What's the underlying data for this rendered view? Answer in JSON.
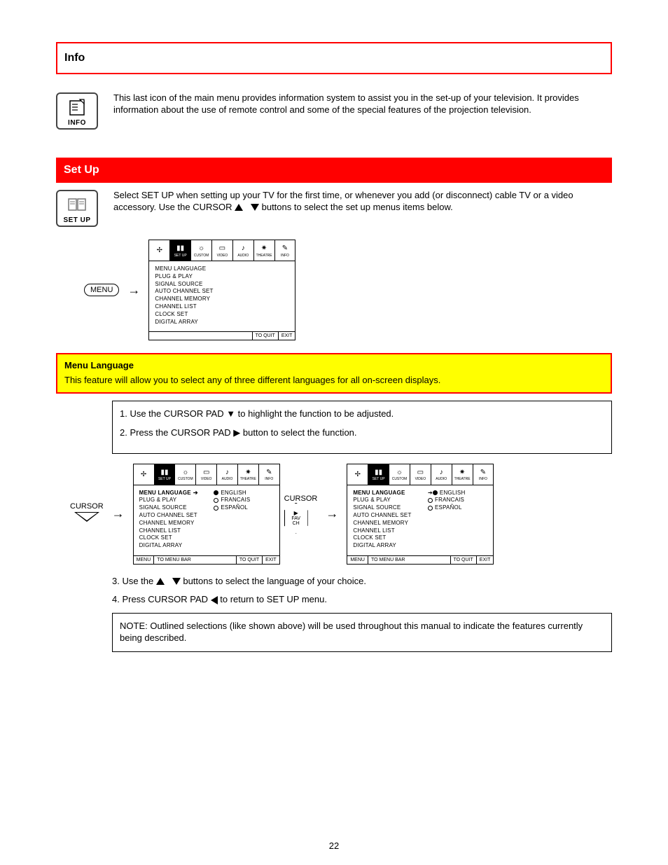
{
  "info_box_title": "Info",
  "info_desc": "This last icon of the main menu provides information system to assist you in the set-up of your television. It provides information about the use of remote control and some of the special features of the projection television.",
  "info_icon_label": "INFO",
  "setup_heading": "Set Up",
  "setup_intro_a": "Select SET UP when setting up your TV for the first time, or whenever you",
  "setup_intro_b": "add (or disconnect) cable TV or a video accessory. Use the CURSOR ",
  "setup_intro_c": " buttons to select the set up menus items below.",
  "setup_icon_label": "SET UP",
  "menu_label": "MENU",
  "cursor_label": "CURSOR",
  "fav_line1": "FAV",
  "fav_line2": "CH",
  "menu_bar": [
    "SET UP",
    "CUSTOM",
    "VIDEO",
    "AUDIO",
    "THEATRE",
    "INFO"
  ],
  "menu_items": [
    "MENU LANGUAGE",
    "PLUG & PLAY",
    "SIGNAL SOURCE",
    "AUTO CHANNEL SET",
    "CHANNEL MEMORY",
    "CHANNEL LIST",
    "CLOCK SET",
    "DIGITAL ARRAY"
  ],
  "lang_options": [
    "ENGLISH",
    "FRANCAIS",
    "ESPAÑOL"
  ],
  "foot_menu": "MENU",
  "foot_menubar": "TO MENU BAR",
  "foot_quit": "TO QUIT",
  "foot_exit": "EXIT",
  "lang_title": "Menu Language",
  "lang_desc": "This feature will allow you to select any of three different languages for all on-screen displays.",
  "step1": "1. Use the CURSOR PAD ▼ to highlight the function to be adjusted.",
  "step2": "2. Press the CURSOR PAD ▶ button to select the function.",
  "step_p1": "3. Use the ",
  "step_p2": " buttons to select the language of your choice.",
  "step_p3": "4. Press CURSOR PAD ",
  "step_p4": " to return to SET UP menu.",
  "note": "NOTE: Outlined selections (like shown above) will be used throughout this  manual to indicate the features currently being described.",
  "page_num": "22"
}
